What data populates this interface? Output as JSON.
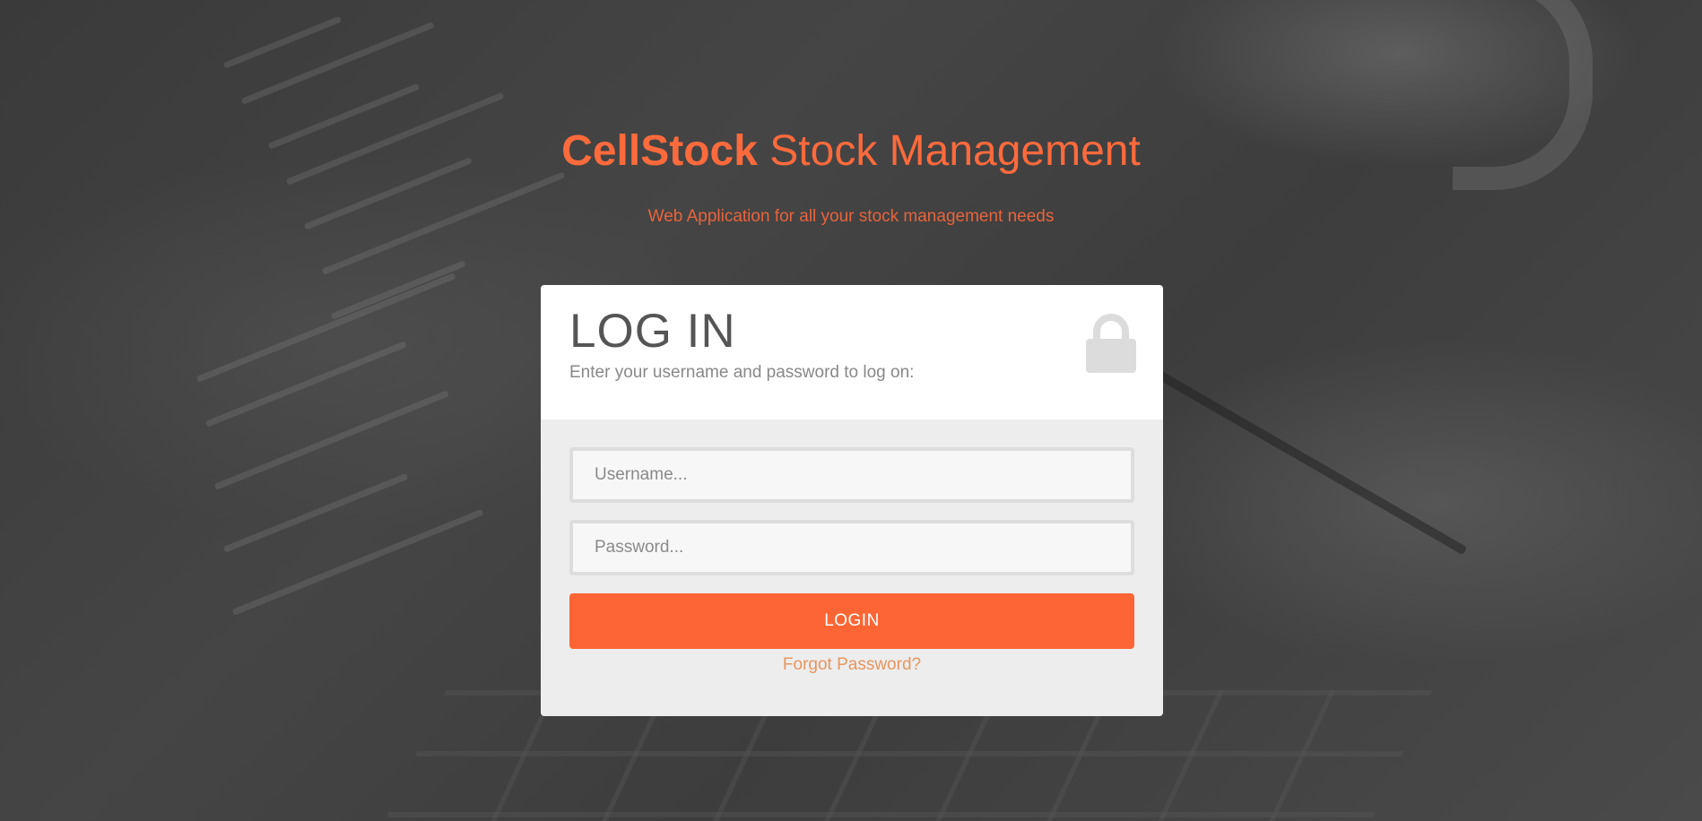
{
  "header": {
    "brand": "CellStock",
    "title_rest": "Stock Management",
    "subtitle": "Web Application for all your stock management needs"
  },
  "login": {
    "title": "LOG IN",
    "description": "Enter your username and password to log on:",
    "icon": "lock-icon",
    "username_placeholder": "Username...",
    "username_value": "",
    "password_placeholder": "Password...",
    "password_value": "",
    "button_label": "LOGIN",
    "forgot_label": "Forgot Password?"
  },
  "colors": {
    "accent": "#fd6634",
    "title_orange": "#fd6a3c",
    "link_orange": "#e8955f",
    "card_top": "#ffffff",
    "card_bottom": "#ededed",
    "background": "#3f3f3f"
  }
}
